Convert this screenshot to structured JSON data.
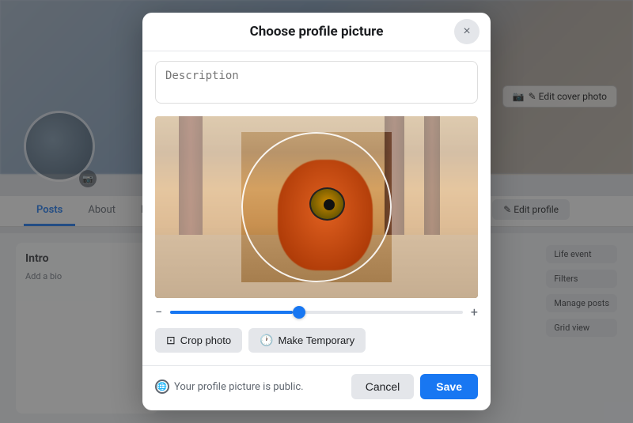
{
  "background": {
    "edit_cover_label": "✎ Edit cover photo",
    "tabs": [
      "Posts",
      "About",
      "Friends"
    ],
    "active_tab": "Posts",
    "edit_profile_label": "✎ Edit profile",
    "intro_title": "Intro",
    "add_bio_label": "Add a bio",
    "life_event_label": "Life event",
    "filters_label": "Filters",
    "manage_posts_label": "Manage posts",
    "grid_view_label": "Grid view"
  },
  "modal": {
    "title": "Choose profile picture",
    "close_label": "×",
    "description_placeholder": "Description",
    "crop_photo_label": "Crop photo",
    "make_temporary_label": "Make Temporary",
    "privacy_text": "Your profile picture is public.",
    "cancel_label": "Cancel",
    "save_label": "Save",
    "zoom_min": "−",
    "zoom_max": "+",
    "zoom_value": 42
  }
}
